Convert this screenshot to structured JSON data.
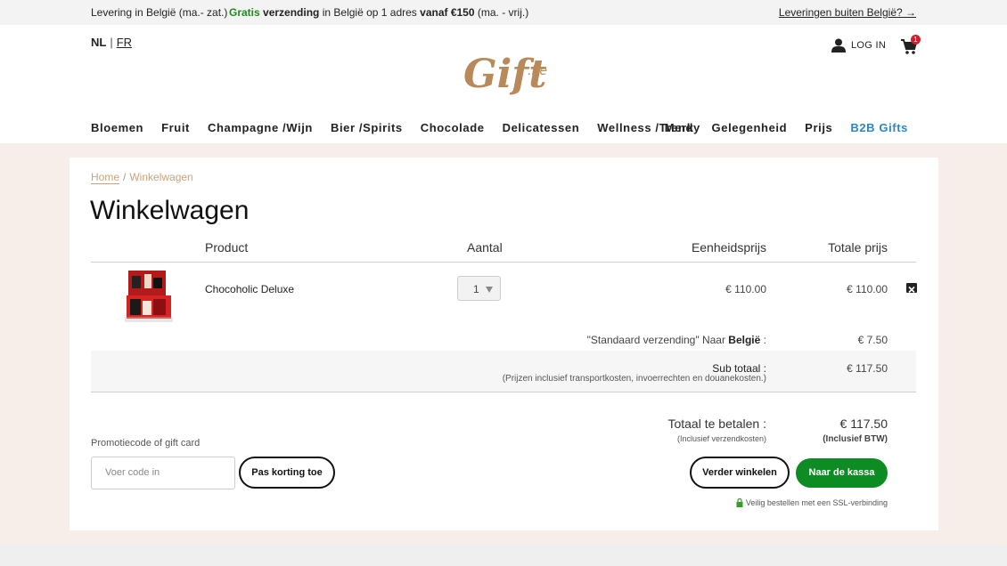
{
  "topbar": {
    "delivery": "Levering in België (ma.- zat.)",
    "free_prefix": "Gratis",
    "free_word": "verzending",
    "free_mid": "in België op 1 adres",
    "free_amount": "vanaf €150",
    "free_suffix": "(ma. - vrij.)",
    "abroad_link": "Leveringen buiten België? →"
  },
  "header": {
    "lang_nl": "NL",
    "lang_sep": "|",
    "lang_fr": "FR",
    "logo_text": "Gift",
    "logo_suffix": ".be",
    "login": "LOG IN",
    "cart_count": "1",
    "nav_left": [
      "Bloemen",
      "Fruit",
      "Champagne /Wijn",
      "Bier /Spirits",
      "Chocolade",
      "Delicatessen",
      "Wellness /Trendy"
    ],
    "nav_right": [
      "Merk",
      "Gelegenheid",
      "Prijs",
      "B2B Gifts"
    ]
  },
  "breadcrumb": {
    "home": "Home",
    "sep": "/",
    "current": "Winkelwagen"
  },
  "page_title": "Winkelwagen",
  "table": {
    "headers": {
      "product": "Product",
      "qty": "Aantal",
      "unit": "Eenheidsprijs",
      "total": "Totale prijs"
    },
    "rows": [
      {
        "name": "Chocoholic Deluxe",
        "qty": "1",
        "unit_price": "€ 110.00",
        "total_price": "€ 110.00"
      }
    ]
  },
  "shipping": {
    "label_quote": "\"Standaard verzending\" Naar",
    "country": "België",
    "colon": ":",
    "value": "€ 7.50"
  },
  "subtotal": {
    "label": "Sub totaal :",
    "note": "(Prijzen inclusief transportkosten, invoerrechten en douanekosten.)",
    "value": "€ 117.50"
  },
  "total": {
    "label": "Totaal te betalen :",
    "note": "(Inclusief verzendkosten)",
    "value": "€ 117.50",
    "tax_note": "(Inclusief BTW)"
  },
  "promo": {
    "label": "Promotiecode of gift card",
    "placeholder": "Voer code in",
    "apply_button": "Pas korting toe"
  },
  "actions": {
    "continue_button": "Verder winkelen",
    "checkout_button": "Naar de kassa",
    "ssl_note": "Veilig bestellen met een SSL-verbinding"
  },
  "colors": {
    "brand_gold": "#b88a5a",
    "accent_green": "#0d8c24",
    "b2b_blue": "#2b87c5",
    "badge_red": "#d0202d"
  },
  "icons": {
    "user": "user-icon",
    "cart": "cart-icon",
    "remove": "remove-icon",
    "lock": "lock-icon"
  }
}
